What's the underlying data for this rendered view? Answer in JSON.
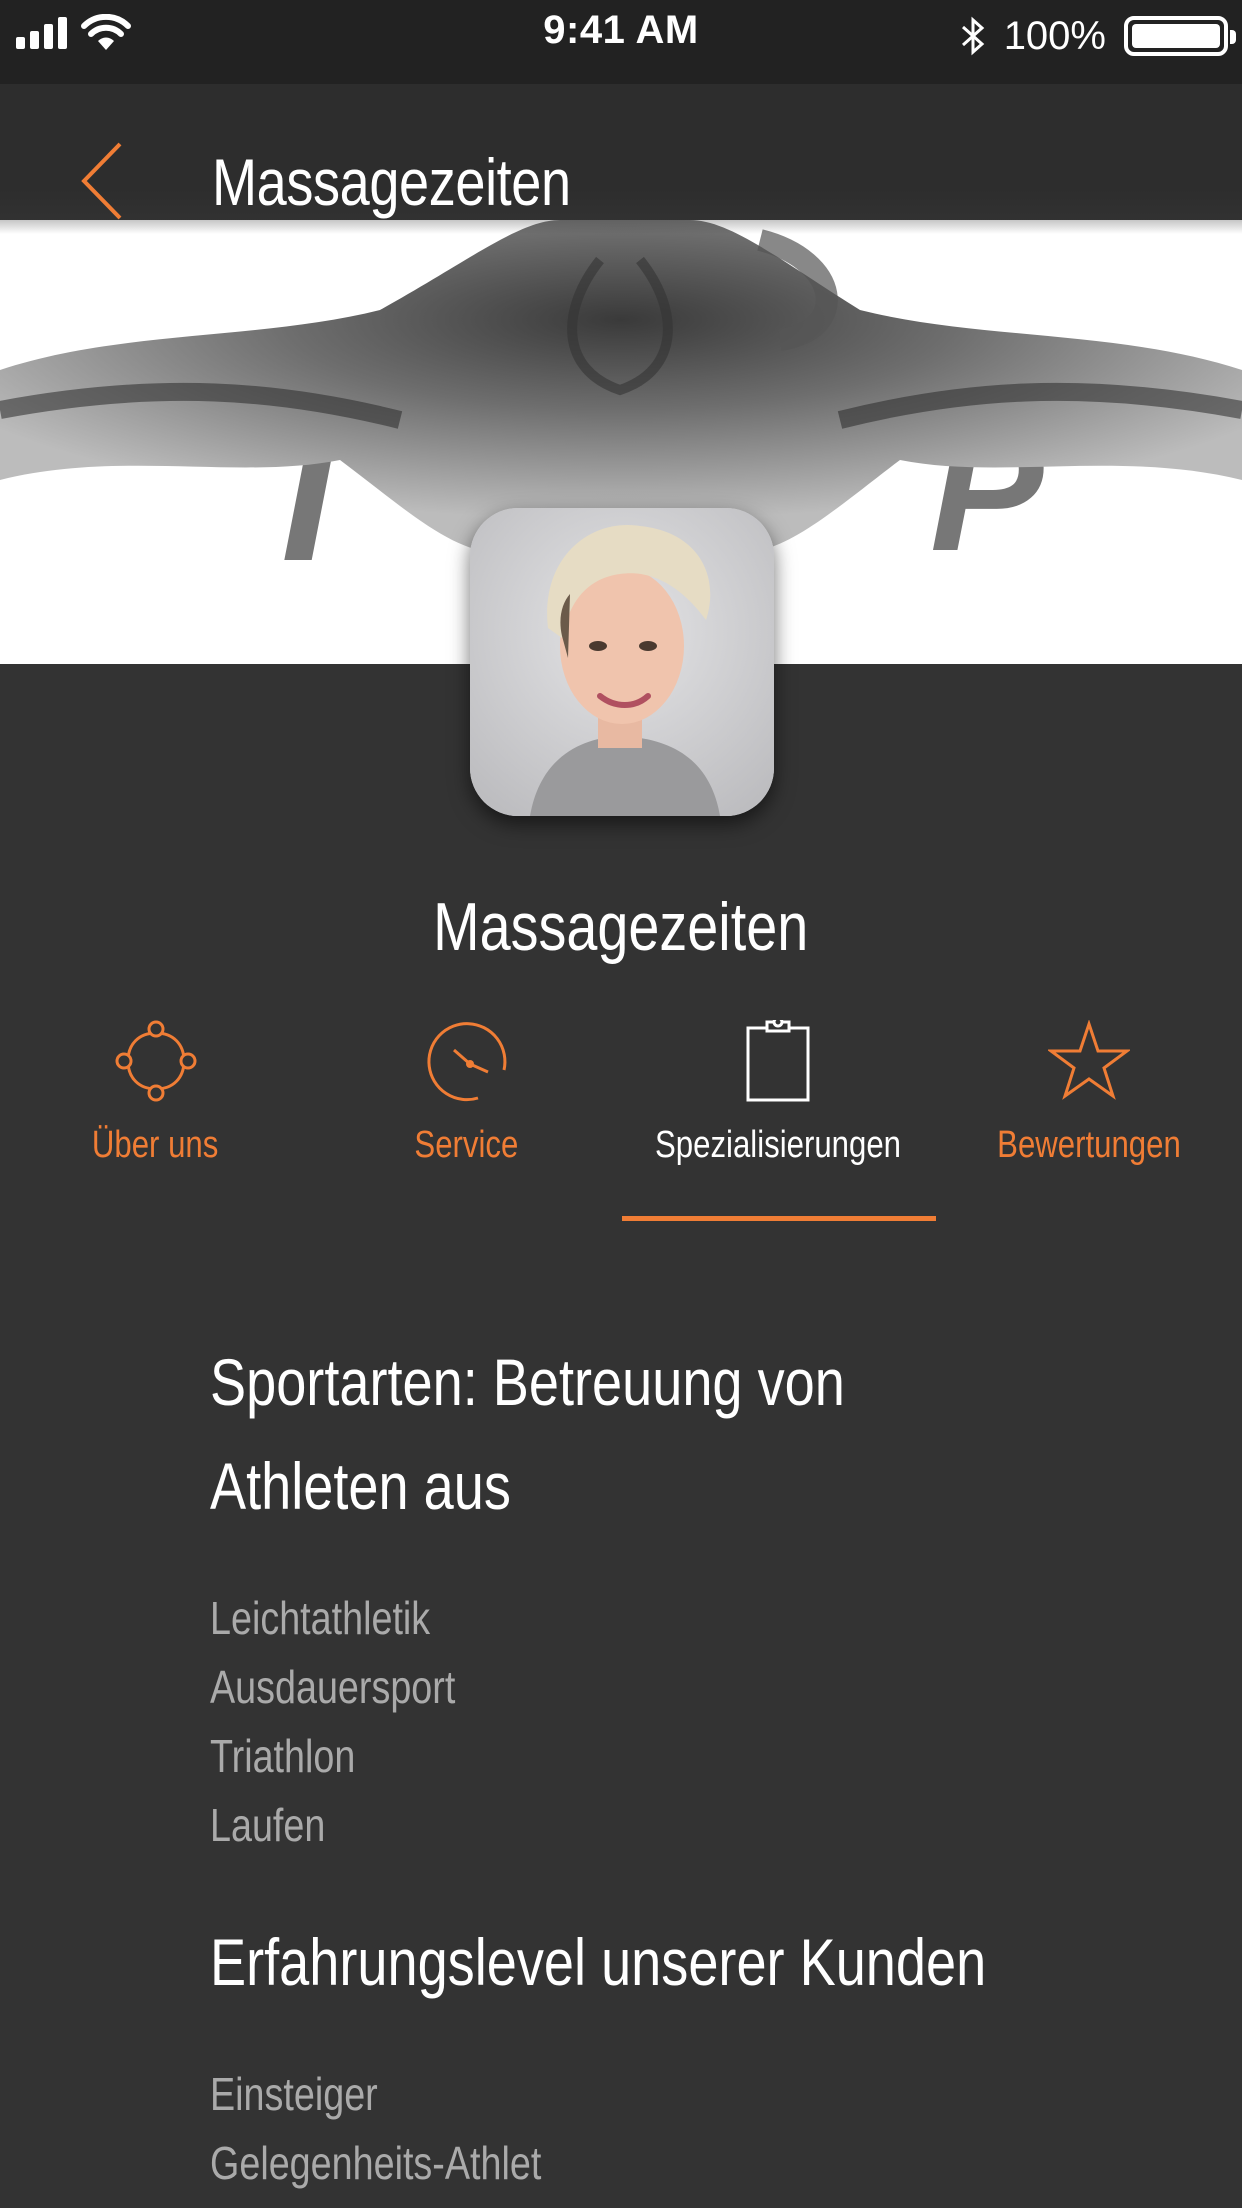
{
  "status_bar": {
    "time": "9:41 AM",
    "battery_percent": "100%",
    "battery_level": 1.0
  },
  "nav": {
    "title": "Massagezeiten",
    "back_icon": "chevron-left-icon"
  },
  "profile": {
    "name": "Massagezeiten"
  },
  "tabs": [
    {
      "label": "Über uns",
      "icon": "network-icon",
      "active": false
    },
    {
      "label": "Service",
      "icon": "gauge-icon",
      "active": false
    },
    {
      "label": "Spezialisierungen",
      "icon": "clipboard-icon",
      "active": true
    },
    {
      "label": "Bewertungen",
      "icon": "star-icon",
      "active": false
    }
  ],
  "sections": [
    {
      "title_lines": [
        "Sportarten: Betreuung von",
        "Athleten aus"
      ],
      "items": [
        "Leichtathletik",
        "Ausdauersport",
        "Triathlon",
        "Laufen"
      ]
    },
    {
      "title_lines": [
        "Erfahrungslevel unserer Kunden"
      ],
      "items": [
        "Einsteiger",
        "Gelegenheits-Athlet"
      ]
    }
  ],
  "colors": {
    "accent": "#f07d35",
    "background": "#333333",
    "status_bar": "#222222",
    "muted_text": "#aaaaaa"
  }
}
